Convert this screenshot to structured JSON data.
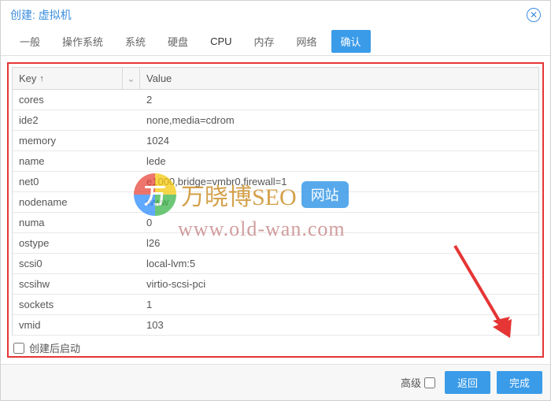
{
  "title": "创建: 虚拟机",
  "tabs": [
    "一般",
    "操作系统",
    "系统",
    "硬盘",
    "CPU",
    "内存",
    "网络"
  ],
  "active_tab_index": 4,
  "confirm_tab": "确认",
  "columns": {
    "key": "Key",
    "value": "Value"
  },
  "sort_indicator": "↑",
  "rows": [
    {
      "k": "cores",
      "v": "2"
    },
    {
      "k": "ide2",
      "v": "none,media=cdrom"
    },
    {
      "k": "memory",
      "v": "1024"
    },
    {
      "k": "name",
      "v": "lede"
    },
    {
      "k": "net0",
      "v": "e1000,bridge=vmbr0,firewall=1"
    },
    {
      "k": "nodename",
      "v": "www"
    },
    {
      "k": "numa",
      "v": "0"
    },
    {
      "k": "ostype",
      "v": "l26"
    },
    {
      "k": "scsi0",
      "v": "local-lvm:5"
    },
    {
      "k": "scsihw",
      "v": "virtio-scsi-pci"
    },
    {
      "k": "sockets",
      "v": "1"
    },
    {
      "k": "vmid",
      "v": "103"
    }
  ],
  "start_after_create_label": "创建后启动",
  "advanced_label": "高级",
  "back_button": "返回",
  "finish_button": "完成",
  "watermark": {
    "logo_char": "万",
    "line1": "万晓博SEO",
    "badge": "网站",
    "line2": "www.old-wan.com"
  }
}
